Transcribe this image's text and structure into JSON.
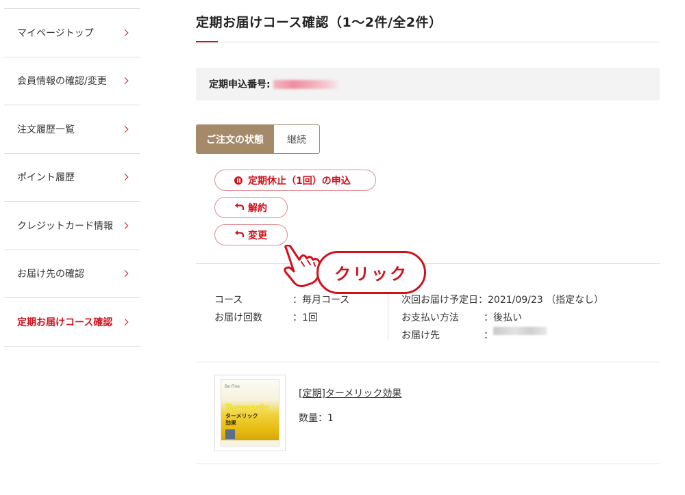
{
  "sidebar": {
    "items": [
      {
        "label": "マイページトップ"
      },
      {
        "label": "会員情報の確認/変更"
      },
      {
        "label": "注文履歴一覧"
      },
      {
        "label": "ポイント履歴"
      },
      {
        "label": "クレジットカード情報"
      },
      {
        "label": "お届け先の確認"
      },
      {
        "label": "定期お届けコース確認"
      }
    ]
  },
  "header": {
    "title": "定期お届けコース確認（1〜2件/全2件）"
  },
  "order": {
    "label": "定期申込番号:"
  },
  "tabs": [
    {
      "label": "ご注文の状態"
    },
    {
      "label": "継続"
    }
  ],
  "actions": {
    "pause_label": "定期休止（1回）の申込",
    "cancel_label": "解約",
    "change_label": "変更"
  },
  "annotation": {
    "click_label": "クリック"
  },
  "details": {
    "course_key": "コース",
    "course_value": "：毎月コース",
    "count_key": "お届け回数",
    "count_value": "：1回",
    "next_key": "次回お届け予定日",
    "next_value": "：2021/09/23 （指定なし）",
    "payment_key": "お支払い方法",
    "payment_value": "：後払い",
    "dest_key": "お届け先",
    "dest_value": "："
  },
  "product": {
    "name": "[定期]ターメリック効果",
    "quantity": "数量：1",
    "package_brand": "Be Fine",
    "package_word": "Turmeric",
    "package_jp": "ターメリック\n効果"
  },
  "colors": {
    "accent": "#d0101b",
    "tab_active": "#a58a6a"
  }
}
